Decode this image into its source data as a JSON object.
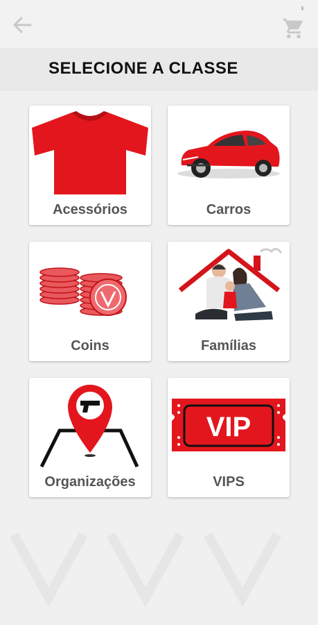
{
  "header": {
    "back_icon": "arrow-left-icon",
    "cart_icon": "shopping-cart-icon",
    "title": "SELECIONE A CLASSE"
  },
  "categories": [
    {
      "id": "acessorios",
      "label": "Acessórios",
      "icon": "shirt-icon"
    },
    {
      "id": "carros",
      "label": "Carros",
      "icon": "car-icon"
    },
    {
      "id": "coins",
      "label": "Coins",
      "icon": "coins-icon"
    },
    {
      "id": "familias",
      "label": "Famílias",
      "icon": "family-house-icon"
    },
    {
      "id": "organizacoes",
      "label": "Organizações",
      "icon": "map-pin-gun-icon"
    },
    {
      "id": "vips",
      "label": "VIPS",
      "icon": "vip-ticket-icon"
    }
  ],
  "vip_ticket_text": "VIP",
  "colors": {
    "accent": "#e3161d",
    "background": "#f0f0f0",
    "label": "#555555"
  }
}
